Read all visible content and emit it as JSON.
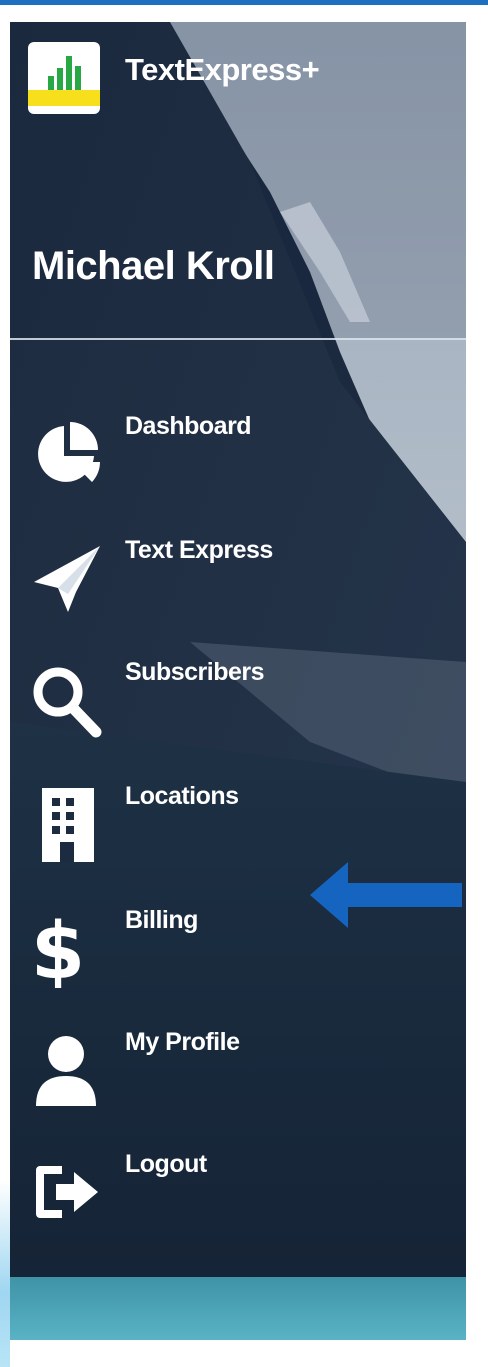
{
  "sidebar": {
    "app_title": "TextExpress+",
    "logo_icon": "bar-chart-logo-icon",
    "user_name": "Michael Kroll",
    "items": [
      {
        "label": "Dashboard",
        "icon": "pie-chart-icon"
      },
      {
        "label": "Text Express",
        "icon": "paper-plane-icon"
      },
      {
        "label": "Subscribers",
        "icon": "search-icon"
      },
      {
        "label": "Locations",
        "icon": "building-icon"
      },
      {
        "label": "Billing",
        "icon": "dollar-icon"
      },
      {
        "label": "My Profile",
        "icon": "user-icon"
      },
      {
        "label": "Logout",
        "icon": "sign-out-icon"
      }
    ]
  },
  "annotation": {
    "pointer_color": "#1565c0"
  },
  "colors": {
    "accent_rule": "#1f6fc1",
    "text": "#ffffff"
  }
}
